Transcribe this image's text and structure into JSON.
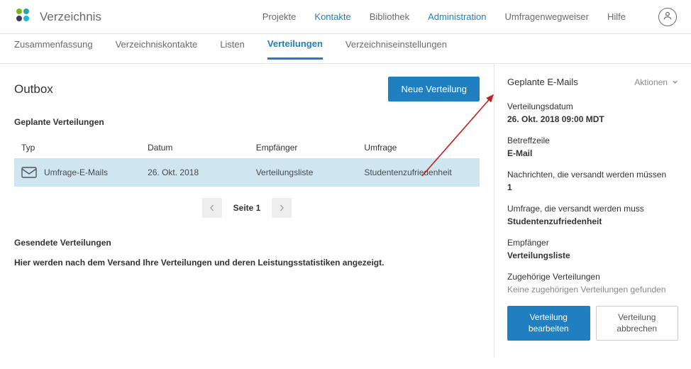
{
  "brand": {
    "title": "Verzeichnis"
  },
  "topnav": {
    "projects": "Projekte",
    "contacts": "Kontakte",
    "library": "Bibliothek",
    "admin": "Administration",
    "surveywizard": "Umfragenwegweiser",
    "help": "Hilfe"
  },
  "subtabs": {
    "summary": "Zusammenfassung",
    "contacts": "Verzeichniskontakte",
    "lists": "Listen",
    "distributions": "Verteilungen",
    "settings": "Verzeichniseinstellungen"
  },
  "main": {
    "title": "Outbox",
    "new_distribution": "Neue Verteilung",
    "planned_title": "Geplante Verteilungen",
    "columns": {
      "typ": "Typ",
      "datum": "Datum",
      "recip": "Empfänger",
      "survey": "Umfrage"
    },
    "rows": [
      {
        "typ": "Umfrage-E-Mails",
        "datum": "26. Okt. 2018",
        "recip": "Verteilungsliste",
        "survey": "Studentenzufriedenheit"
      }
    ],
    "pager": {
      "label": "Seite 1"
    },
    "sent_title": "Gesendete Verteilungen",
    "sent_empty": "Hier werden nach dem Versand Ihre Verteilungen und deren Leistungsstatistiken angezeigt."
  },
  "side": {
    "title": "Geplante E-Mails",
    "actions": "Aktionen",
    "fields": {
      "date_label": "Verteilungsdatum",
      "date_value": "26. Okt. 2018 09:00 MDT",
      "subject_label": "Betreffzeile",
      "subject_value": "E-Mail",
      "messages_label": "Nachrichten, die versandt werden müssen",
      "messages_value": "1",
      "survey_label": "Umfrage, die versandt werden muss",
      "survey_value": "Studentenzufriedenheit",
      "recip_label": "Empfänger",
      "recip_value": "Verteilungsliste",
      "related_label": "Zugehörige Verteilungen",
      "related_value": "Keine zugehörigen Verteilungen gefunden"
    },
    "buttons": {
      "edit": "Verteilung bearbeiten",
      "cancel": "Verteilung abbrechen"
    }
  }
}
